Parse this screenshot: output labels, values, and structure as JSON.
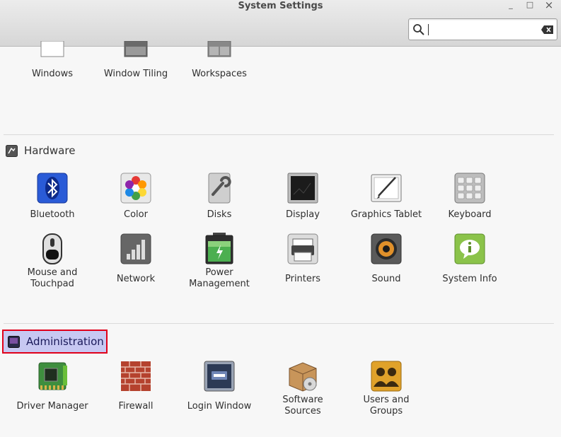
{
  "window": {
    "title": "System Settings",
    "minimize": "_",
    "maximize": "□",
    "close": "×"
  },
  "search": {
    "value": "",
    "placeholder": ""
  },
  "top_row": [
    {
      "label": "Windows"
    },
    {
      "label": "Window Tiling"
    },
    {
      "label": "Workspaces"
    }
  ],
  "hardware": {
    "title": "Hardware",
    "items": [
      {
        "label": "Bluetooth"
      },
      {
        "label": "Color"
      },
      {
        "label": "Disks"
      },
      {
        "label": "Display"
      },
      {
        "label": "Graphics Tablet"
      },
      {
        "label": "Keyboard"
      },
      {
        "label": "Mouse and\nTouchpad"
      },
      {
        "label": "Network"
      },
      {
        "label": "Power\nManagement"
      },
      {
        "label": "Printers"
      },
      {
        "label": "Sound"
      },
      {
        "label": "System Info"
      }
    ]
  },
  "administration": {
    "title": "Administration",
    "items": [
      {
        "label": "Driver Manager"
      },
      {
        "label": "Firewall"
      },
      {
        "label": "Login Window"
      },
      {
        "label": "Software\nSources"
      },
      {
        "label": "Users and\nGroups"
      }
    ]
  }
}
